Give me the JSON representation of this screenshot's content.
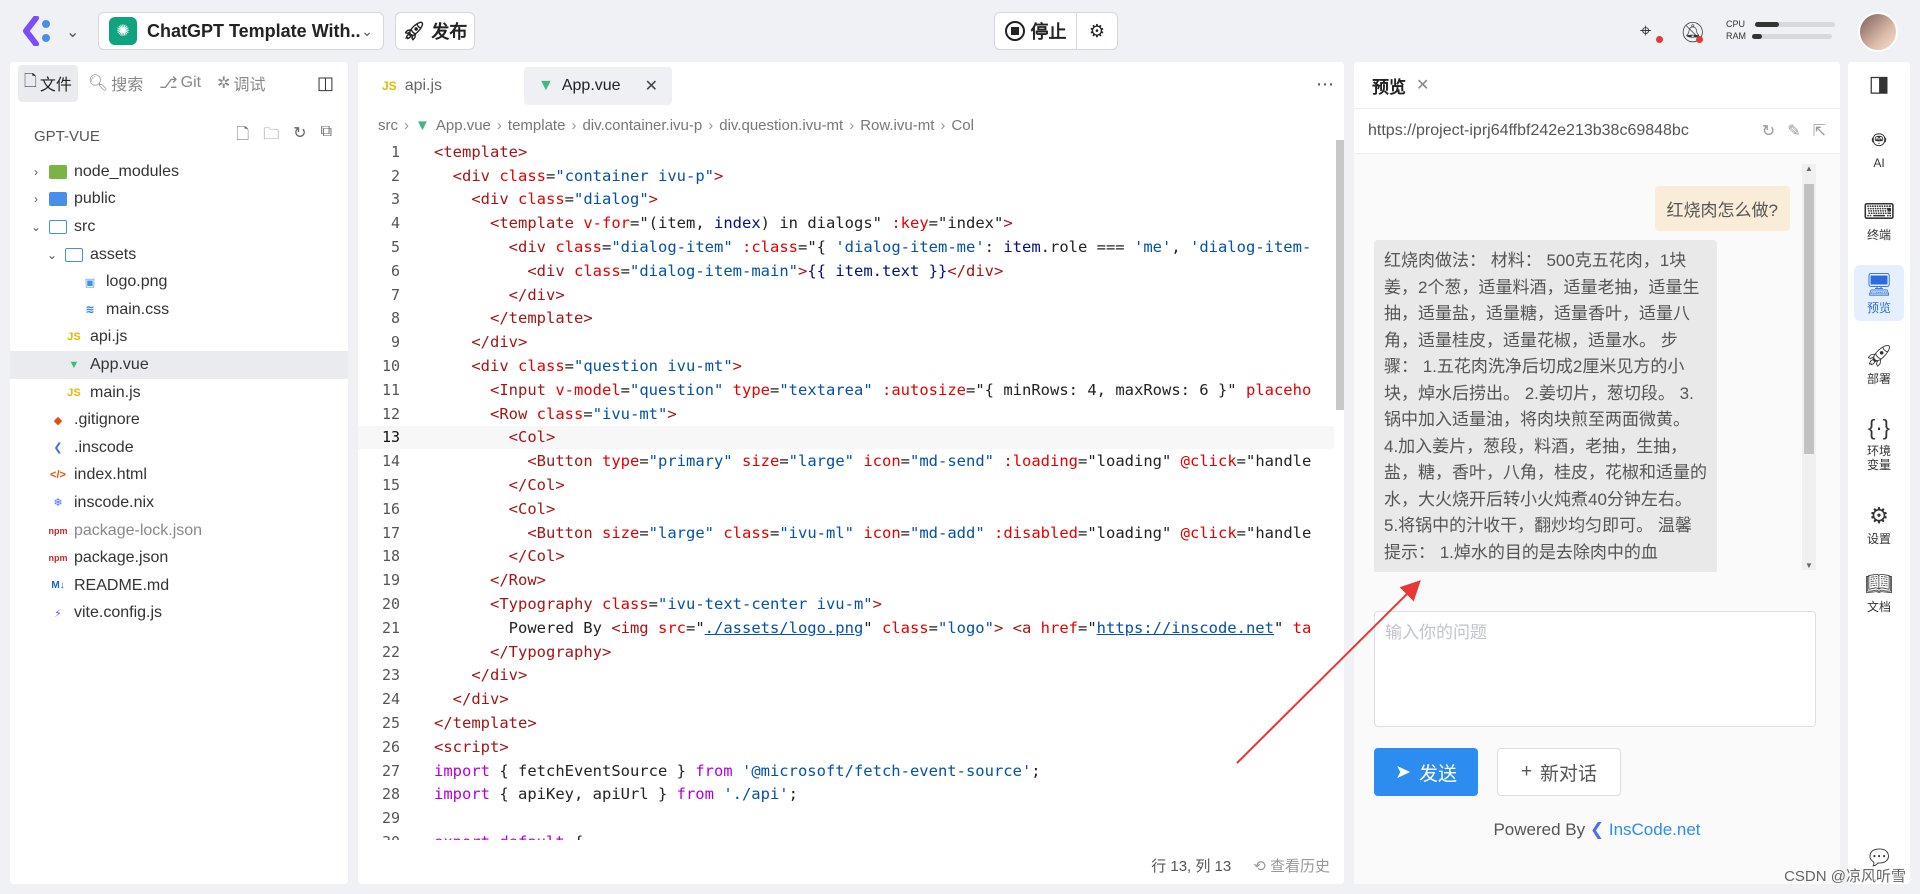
{
  "topbar": {
    "project_name": "ChatGPT Template With...",
    "publish_label": "发布",
    "stop_label": "停止",
    "cpu_label": "CPU",
    "ram_label": "RAM",
    "cpu_usage": 0.3,
    "ram_usage": 0.12
  },
  "explorer": {
    "tabs": [
      {
        "label": "文件"
      },
      {
        "label": "搜索"
      },
      {
        "label": "Git"
      },
      {
        "label": "调试"
      }
    ],
    "project_title": "GPT-VUE",
    "tree": [
      {
        "name": "node_modules",
        "depth": 0,
        "type": "folder-green",
        "arrow": "›"
      },
      {
        "name": "public",
        "depth": 0,
        "type": "folder",
        "arrow": "›"
      },
      {
        "name": "src",
        "depth": 0,
        "type": "folder-open",
        "arrow": "⌄"
      },
      {
        "name": "assets",
        "depth": 1,
        "type": "folder-open",
        "arrow": "⌄"
      },
      {
        "name": "logo.png",
        "depth": 2,
        "type": "png"
      },
      {
        "name": "main.css",
        "depth": 2,
        "type": "css"
      },
      {
        "name": "api.js",
        "depth": 1,
        "type": "js"
      },
      {
        "name": "App.vue",
        "depth": 1,
        "type": "vue",
        "selected": true
      },
      {
        "name": "main.js",
        "depth": 1,
        "type": "js"
      },
      {
        "name": ".gitignore",
        "depth": 0,
        "type": "git"
      },
      {
        "name": ".inscode",
        "depth": 0,
        "type": "ins"
      },
      {
        "name": "index.html",
        "depth": 0,
        "type": "html"
      },
      {
        "name": "inscode.nix",
        "depth": 0,
        "type": "nix"
      },
      {
        "name": "package-lock.json",
        "depth": 0,
        "type": "npm",
        "dim": true
      },
      {
        "name": "package.json",
        "depth": 0,
        "type": "npm"
      },
      {
        "name": "README.md",
        "depth": 0,
        "type": "md"
      },
      {
        "name": "vite.config.js",
        "depth": 0,
        "type": "vite"
      }
    ]
  },
  "editor": {
    "tabs": [
      {
        "label": "api.js",
        "active": false
      },
      {
        "label": "App.vue",
        "active": true
      }
    ],
    "breadcrumb": [
      "src",
      "App.vue",
      "template",
      "div.container.ivu-p",
      "div.question.ivu-mt",
      "Row.ivu-mt",
      "Col"
    ],
    "current_line": 13,
    "lines": [
      [
        [
          "tag",
          "<template>"
        ]
      ],
      [
        [
          "sp",
          "  "
        ],
        [
          "tag",
          "<div "
        ],
        [
          "attr",
          "class"
        ],
        [
          "text",
          "="
        ],
        [
          "str",
          "\"container ivu-p\""
        ],
        [
          "tag",
          ">"
        ]
      ],
      [
        [
          "sp",
          "    "
        ],
        [
          "tag",
          "<div "
        ],
        [
          "attr",
          "class"
        ],
        [
          "text",
          "="
        ],
        [
          "str",
          "\"dialog\""
        ],
        [
          "tag",
          ">"
        ]
      ],
      [
        [
          "sp",
          "      "
        ],
        [
          "tag",
          "<template "
        ],
        [
          "attr",
          "v-for"
        ],
        [
          "text",
          "=\"(item, "
        ],
        [
          "var",
          "index"
        ],
        [
          "text",
          ") in dialogs\" "
        ],
        [
          "attr",
          ":key"
        ],
        [
          "text",
          "=\"index\""
        ],
        [
          "tag",
          ">"
        ]
      ],
      [
        [
          "sp",
          "        "
        ],
        [
          "tag",
          "<div "
        ],
        [
          "attr",
          "class"
        ],
        [
          "text",
          "="
        ],
        [
          "str",
          "\"dialog-item\""
        ],
        [
          "text",
          " "
        ],
        [
          "attr",
          ":class"
        ],
        [
          "text",
          "=\"{ "
        ],
        [
          "str",
          "'dialog-item-me'"
        ],
        [
          "text",
          ": "
        ],
        [
          "var",
          "item"
        ],
        [
          "text",
          ".role === "
        ],
        [
          "str",
          "'me'"
        ],
        [
          "text",
          ", "
        ],
        [
          "str",
          "'dialog-item-"
        ]
      ],
      [
        [
          "sp",
          "          "
        ],
        [
          "tag",
          "<div "
        ],
        [
          "attr",
          "class"
        ],
        [
          "text",
          "="
        ],
        [
          "str",
          "\"dialog-item-main\""
        ],
        [
          "tag",
          ">"
        ],
        [
          "var",
          "{{ item.text }}"
        ],
        [
          "tag",
          "</div>"
        ]
      ],
      [
        [
          "sp",
          "        "
        ],
        [
          "tag",
          "</div>"
        ]
      ],
      [
        [
          "sp",
          "      "
        ],
        [
          "tag",
          "</template>"
        ]
      ],
      [
        [
          "sp",
          "    "
        ],
        [
          "tag",
          "</div>"
        ]
      ],
      [
        [
          "sp",
          "    "
        ],
        [
          "tag",
          "<div "
        ],
        [
          "attr",
          "class"
        ],
        [
          "text",
          "="
        ],
        [
          "str",
          "\"question ivu-mt\""
        ],
        [
          "tag",
          ">"
        ]
      ],
      [
        [
          "sp",
          "      "
        ],
        [
          "tag",
          "<Input "
        ],
        [
          "attr",
          "v-model"
        ],
        [
          "text",
          "="
        ],
        [
          "str",
          "\"question\""
        ],
        [
          "text",
          " "
        ],
        [
          "attr",
          "type"
        ],
        [
          "text",
          "="
        ],
        [
          "str",
          "\"textarea\""
        ],
        [
          "text",
          " "
        ],
        [
          "attr",
          ":autosize"
        ],
        [
          "text",
          "=\"{ minRows: 4, maxRows: 6 }\" "
        ],
        [
          "attr",
          "placeho"
        ]
      ],
      [
        [
          "sp",
          "      "
        ],
        [
          "tag",
          "<Row "
        ],
        [
          "attr",
          "class"
        ],
        [
          "text",
          "="
        ],
        [
          "str",
          "\"ivu-mt\""
        ],
        [
          "tag",
          ">"
        ]
      ],
      [
        [
          "sp",
          "        "
        ],
        [
          "tag",
          "<Col>"
        ]
      ],
      [
        [
          "sp",
          "          "
        ],
        [
          "tag",
          "<Button "
        ],
        [
          "attr",
          "type"
        ],
        [
          "text",
          "="
        ],
        [
          "str",
          "\"primary\""
        ],
        [
          "text",
          " "
        ],
        [
          "attr",
          "size"
        ],
        [
          "text",
          "="
        ],
        [
          "str",
          "\"large\""
        ],
        [
          "text",
          " "
        ],
        [
          "attr",
          "icon"
        ],
        [
          "text",
          "="
        ],
        [
          "str",
          "\"md-send\""
        ],
        [
          "text",
          " "
        ],
        [
          "attr",
          ":loading"
        ],
        [
          "text",
          "=\"loading\" "
        ],
        [
          "attr",
          "@click"
        ],
        [
          "text",
          "=\"handle"
        ]
      ],
      [
        [
          "sp",
          "        "
        ],
        [
          "tag",
          "</Col>"
        ]
      ],
      [
        [
          "sp",
          "        "
        ],
        [
          "tag",
          "<Col>"
        ]
      ],
      [
        [
          "sp",
          "          "
        ],
        [
          "tag",
          "<Button "
        ],
        [
          "attr",
          "size"
        ],
        [
          "text",
          "="
        ],
        [
          "str",
          "\"large\""
        ],
        [
          "text",
          " "
        ],
        [
          "attr",
          "class"
        ],
        [
          "text",
          "="
        ],
        [
          "str",
          "\"ivu-ml\""
        ],
        [
          "text",
          " "
        ],
        [
          "attr",
          "icon"
        ],
        [
          "text",
          "="
        ],
        [
          "str",
          "\"md-add\""
        ],
        [
          "text",
          " "
        ],
        [
          "attr",
          ":disabled"
        ],
        [
          "text",
          "=\"loading\" "
        ],
        [
          "attr",
          "@click"
        ],
        [
          "text",
          "=\"handle"
        ]
      ],
      [
        [
          "sp",
          "        "
        ],
        [
          "tag",
          "</Col>"
        ]
      ],
      [
        [
          "sp",
          "      "
        ],
        [
          "tag",
          "</Row>"
        ]
      ],
      [
        [
          "sp",
          "      "
        ],
        [
          "tag",
          "<Typography "
        ],
        [
          "attr",
          "class"
        ],
        [
          "text",
          "="
        ],
        [
          "str",
          "\"ivu-text-center ivu-m\""
        ],
        [
          "tag",
          ">"
        ]
      ],
      [
        [
          "sp",
          "        "
        ],
        [
          "text",
          "Powered By "
        ],
        [
          "tag",
          "<img "
        ],
        [
          "attr",
          "src"
        ],
        [
          "text",
          "=\""
        ],
        [
          "link",
          "./assets/logo.png"
        ],
        [
          "text",
          "\" "
        ],
        [
          "attr",
          "class"
        ],
        [
          "text",
          "="
        ],
        [
          "str",
          "\"logo\""
        ],
        [
          "tag",
          "> <a "
        ],
        [
          "attr",
          "href"
        ],
        [
          "text",
          "=\""
        ],
        [
          "link",
          "https://inscode.net"
        ],
        [
          "text",
          "\" "
        ],
        [
          "attr",
          "ta"
        ]
      ],
      [
        [
          "sp",
          "      "
        ],
        [
          "tag",
          "</Typography>"
        ]
      ],
      [
        [
          "sp",
          "    "
        ],
        [
          "tag",
          "</div>"
        ]
      ],
      [
        [
          "sp",
          "  "
        ],
        [
          "tag",
          "</div>"
        ]
      ],
      [
        [
          "tag",
          "</template>"
        ]
      ],
      [
        [
          "tag",
          "<script>"
        ]
      ],
      [
        [
          "kw",
          "import"
        ],
        [
          "text",
          " { fetchEventSource } "
        ],
        [
          "kw",
          "from"
        ],
        [
          "text",
          " "
        ],
        [
          "str",
          "'@microsoft/fetch-event-source'"
        ],
        [
          "text",
          ";"
        ]
      ],
      [
        [
          "kw",
          "import"
        ],
        [
          "text",
          " { apiKey, apiUrl } "
        ],
        [
          "kw",
          "from"
        ],
        [
          "text",
          " "
        ],
        [
          "str",
          "'./api'"
        ],
        [
          "text",
          ";"
        ]
      ],
      [],
      [
        [
          "kw",
          "export default"
        ],
        [
          "text",
          " {"
        ]
      ]
    ],
    "status_position": "行 13, 列 13",
    "status_history": "查看历史"
  },
  "preview": {
    "title": "预览",
    "url": "https://project-iprj64ffbf242e213b38c69848bc",
    "user_message": "红烧肉怎么做?",
    "ai_message": "红烧肉做法： 材料： 500克五花肉，1块姜，2个葱，适量料酒，适量老抽，适量生抽，适量盐，适量糖，适量香叶，适量八角，适量桂皮，适量花椒，适量水。 步骤： 1.五花肉洗净后切成2厘米见方的小块，焯水后捞出。 2.姜切片，葱切段。 3.锅中加入适量油，将肉块煎至两面微黄。 4.加入姜片，葱段，料酒，老抽，生抽，盐，糖，香叶，八角，桂皮，花椒和适量的水，大火烧开后转小火炖煮40分钟左右。 5.将锅中的汁收干，翻炒均匀即可。 温馨提示： 1.焯水的目的是去除肉中的血",
    "input_placeholder": "输入你的问题",
    "send_label": "发送",
    "new_chat_label": "新对话",
    "powered_by": "Powered By",
    "brand": "InsCode.net"
  },
  "rightbar": [
    {
      "label": "AI",
      "icon": "robot-icon"
    },
    {
      "label": "终端",
      "icon": "terminal-icon"
    },
    {
      "label": "预览",
      "icon": "monitor-icon",
      "active": true
    },
    {
      "label": "部署",
      "icon": "rocket-icon"
    },
    {
      "label": "环境变量",
      "icon": "braces-icon"
    },
    {
      "label": "设置",
      "icon": "gear-icon"
    },
    {
      "label": "文档",
      "icon": "book-icon"
    }
  ],
  "watermark": "CSDN @凉风听雪"
}
